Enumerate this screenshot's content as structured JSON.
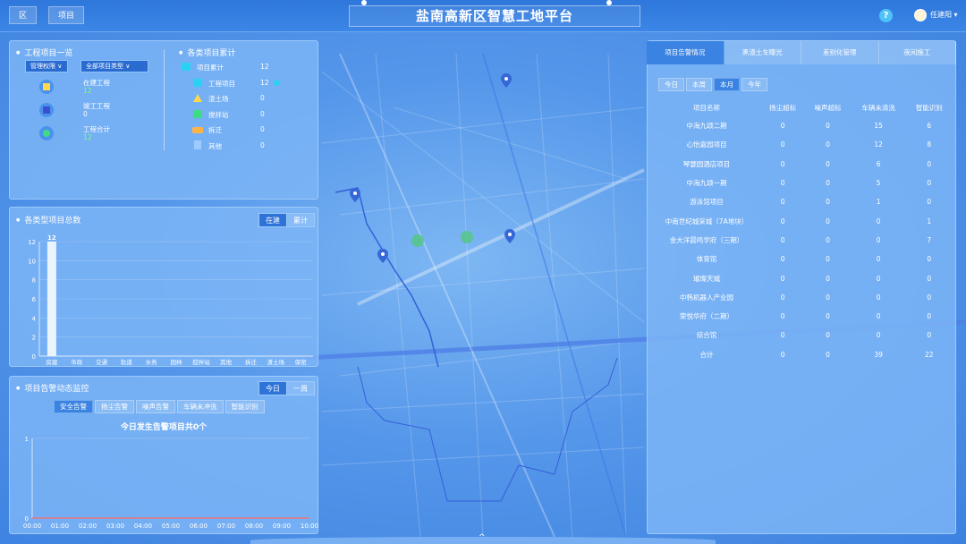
{
  "header": {
    "left_buttons": [
      "区",
      "项目"
    ],
    "title": "盐南高新区智慧工地平台",
    "help_icon": "?",
    "user_name": "任建阳 ▾"
  },
  "project_overview": {
    "title": "工程项目一览",
    "filter_permission": "管理权限 ∨",
    "filter_type": "全部项目类型 ∨",
    "stats": [
      {
        "label": "在建工程",
        "value": "12",
        "icon": "building-icon",
        "color": "#ffd84d"
      },
      {
        "label": "竣工工程",
        "value": "0",
        "icon": "flag-icon",
        "color": "#3a4fd1"
      },
      {
        "label": "工程合计",
        "value": "12",
        "icon": "star-icon",
        "color": "#3ddc84"
      }
    ]
  },
  "project_totals": {
    "title": "各类项目累计",
    "rows": [
      {
        "label": "项目累计",
        "value": "12",
        "icon": "layers-icon",
        "color": "#2bd1f4"
      },
      {
        "label": "工程项目",
        "value": "12",
        "icon": "building-icon",
        "color": "#2bd1f4"
      },
      {
        "label": "渣土场",
        "value": "0",
        "icon": "mountain-icon",
        "color": "#ffd84d"
      },
      {
        "label": "搅拌站",
        "value": "0",
        "icon": "mixer-icon",
        "color": "#3ddc84"
      },
      {
        "label": "拆迁",
        "value": "0",
        "icon": "truck-icon",
        "color": "#ffb347"
      },
      {
        "label": "其他",
        "value": "0",
        "icon": "document-icon",
        "color": "#9ecbff"
      }
    ]
  },
  "type_chart": {
    "title": "各类型项目总数",
    "toggle": [
      "在建",
      "累计"
    ]
  },
  "chart_data": [
    {
      "type": "bar",
      "categories": [
        "房建",
        "市政",
        "交通",
        "轨道",
        "水务",
        "园林",
        "搅拌站",
        "其他",
        "拆迁",
        "渣土场",
        "保密"
      ],
      "values": [
        12,
        0,
        0,
        0,
        0,
        0,
        0,
        0,
        0,
        0,
        0
      ],
      "y_ticks": [
        "0",
        "2",
        "4",
        "6",
        "8",
        "10",
        "12"
      ],
      "data_labels": [
        "12"
      ],
      "ylim": [
        0,
        12
      ]
    },
    {
      "type": "line",
      "categories": [
        "00:00",
        "01:00",
        "02:00",
        "03:00",
        "04:00",
        "05:00",
        "06:00",
        "07:00",
        "08:00",
        "09:00",
        "10:00"
      ],
      "values": [
        0,
        0,
        0,
        0,
        0,
        0,
        0,
        0,
        0,
        0,
        0
      ],
      "y_ticks": [
        "0",
        "1"
      ],
      "ylim": [
        0,
        1
      ]
    }
  ],
  "alarm_monitor": {
    "title": "项目告警动态监控",
    "toggle": [
      "今日",
      "一周"
    ],
    "tabs": [
      "安全告警",
      "扬尘告警",
      "噪声告警",
      "车辆未冲洗",
      "智能识别"
    ],
    "summary": "今日发生告警项目共0个"
  },
  "right_panel": {
    "tabs": [
      "项目告警情况",
      "黑渣土车曝光",
      "差别化管理",
      "夜间施工"
    ],
    "periods": [
      "今日",
      "本周",
      "本月",
      "今年"
    ],
    "columns": [
      "项目名称",
      "扬尘超标",
      "噪声超标",
      "车辆未清洗",
      "智能识别"
    ],
    "rows": [
      [
        "中海九颂二期",
        "0",
        "0",
        "15",
        "6"
      ],
      [
        "心怡嘉园项目",
        "0",
        "0",
        "12",
        "8"
      ],
      [
        "琴瑟园酒店项目",
        "0",
        "0",
        "6",
        "0"
      ],
      [
        "中海九颂一期",
        "0",
        "0",
        "5",
        "0"
      ],
      [
        "游泳馆项目",
        "0",
        "0",
        "1",
        "0"
      ],
      [
        "中南世纪城采城（7A地块）",
        "0",
        "0",
        "0",
        "1"
      ],
      [
        "金大洋晨鸣学府（三期）",
        "0",
        "0",
        "0",
        "7"
      ],
      [
        "体育馆",
        "0",
        "0",
        "0",
        "0"
      ],
      [
        "璀璨天城",
        "0",
        "0",
        "0",
        "0"
      ],
      [
        "中韩机器人产业园",
        "0",
        "0",
        "0",
        "0"
      ],
      [
        "荣悦华府（二期）",
        "0",
        "0",
        "0",
        "0"
      ],
      [
        "综合馆",
        "0",
        "0",
        "0",
        "0"
      ],
      [
        "合计",
        "0",
        "0",
        "39",
        "22"
      ]
    ]
  },
  "footer": {
    "expand_icon": "^"
  }
}
